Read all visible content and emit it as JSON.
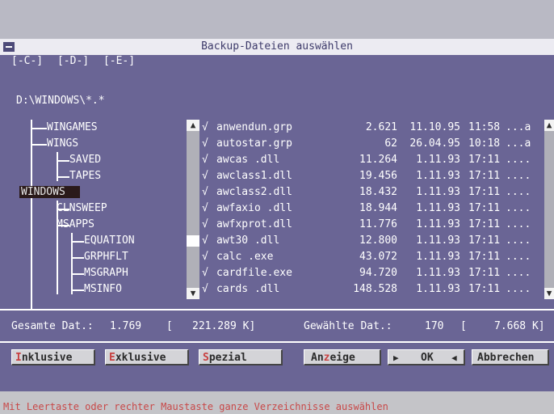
{
  "window": {
    "title": "Backup-Dateien auswählen"
  },
  "drives": [
    "[-C-]",
    "[-D-]",
    "[-E-]"
  ],
  "path": "D:\\WINDOWS\\*.*",
  "tree": [
    {
      "label": "WINGAMES",
      "name": "tree-item-wingames"
    },
    {
      "label": "WINGS",
      "name": "tree-item-wings"
    },
    {
      "label": "SAVED",
      "name": "tree-item-saved"
    },
    {
      "label": "TAPES",
      "name": "tree-item-tapes"
    },
    {
      "label": "WINDOWS",
      "name": "tree-item-windows",
      "selected": true
    },
    {
      "label": "CLNSWEEP",
      "name": "tree-item-clnsweep"
    },
    {
      "label": "MSAPPS",
      "name": "tree-item-msapps"
    },
    {
      "label": "EQUATION",
      "name": "tree-item-equation"
    },
    {
      "label": "GRPHFLT",
      "name": "tree-item-grphflt"
    },
    {
      "label": "MSGRAPH",
      "name": "tree-item-msgraph"
    },
    {
      "label": "MSINFO",
      "name": "tree-item-msinfo"
    }
  ],
  "files": [
    {
      "check": "√",
      "name": "anwendun.grp",
      "size": "2.621",
      "date": "11.10.95",
      "time": "11:58",
      "attr": "...a"
    },
    {
      "check": "√",
      "name": "autostar.grp",
      "size": "62",
      "date": "26.04.95",
      "time": "10:18",
      "attr": "...a"
    },
    {
      "check": "√",
      "name": "awcas    .dll",
      "size": "11.264",
      "date": "1.11.93",
      "time": "17:11",
      "attr": "...."
    },
    {
      "check": "√",
      "name": "awclass1.dll",
      "size": "19.456",
      "date": "1.11.93",
      "time": "17:11",
      "attr": "...."
    },
    {
      "check": "√",
      "name": "awclass2.dll",
      "size": "18.432",
      "date": "1.11.93",
      "time": "17:11",
      "attr": "...."
    },
    {
      "check": "√",
      "name": "awfaxio  .dll",
      "size": "18.944",
      "date": "1.11.93",
      "time": "17:11",
      "attr": "...."
    },
    {
      "check": "√",
      "name": "awfxprot.dll",
      "size": "11.776",
      "date": "1.11.93",
      "time": "17:11",
      "attr": "...."
    },
    {
      "check": "√",
      "name": "awt30    .dll",
      "size": "12.800",
      "date": "1.11.93",
      "time": "17:11",
      "attr": "...."
    },
    {
      "check": "√",
      "name": "calc     .exe",
      "size": "43.072",
      "date": "1.11.93",
      "time": "17:11",
      "attr": "...."
    },
    {
      "check": "√",
      "name": "cardfile.exe",
      "size": "94.720",
      "date": "1.11.93",
      "time": "17:11",
      "attr": "...."
    },
    {
      "check": "√",
      "name": "cards    .dll",
      "size": "148.528",
      "date": "1.11.93",
      "time": "17:11",
      "attr": "...."
    }
  ],
  "summary": {
    "total_label": "Gesamte Dat.:",
    "total_count": "1.769",
    "bracket_open": "[",
    "total_size": "221.289 K]",
    "selected_label": "Gewählte Dat.:",
    "selected_count": "170",
    "selected_bracket": "[",
    "selected_size": "7.668 K]"
  },
  "buttons": {
    "inklusive": {
      "hot": "I",
      "rest": "nklusive"
    },
    "exklusive": {
      "hot": "E",
      "rest": "xklusive"
    },
    "spezial": {
      "hot": "S",
      "rest": "pezial"
    },
    "anzeige": {
      "pre": "An",
      "hot": "z",
      "rest": "eige"
    },
    "ok": "OK",
    "abbrechen": "Abbrechen"
  },
  "status": "Mit Leertaste oder rechter Maustaste ganze Verzeichnisse auswählen",
  "colors": {
    "background": "#6a6595",
    "accent_hotkey": "#c84040",
    "status_text": "#c84848"
  }
}
